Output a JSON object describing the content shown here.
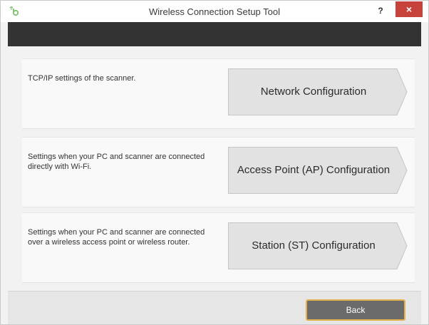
{
  "window": {
    "title": "Wireless Connection Setup Tool",
    "help_label": "?",
    "close_label": "×"
  },
  "options": [
    {
      "description": "TCP/IP settings of the scanner.",
      "button_label": "Network Configuration"
    },
    {
      "description": "Settings when your PC and scanner are connected directly with Wi-Fi.",
      "button_label": "Access Point (AP) Configuration"
    },
    {
      "description": "Settings when your PC and scanner are connected over a wireless access point or wireless router.",
      "button_label": "Station (ST) Configuration"
    }
  ],
  "footer": {
    "back_label": "Back"
  },
  "colors": {
    "banner": "#333333",
    "close_button": "#c7423a",
    "back_button": "#6b6b6b",
    "back_button_border": "#e4b04a"
  }
}
